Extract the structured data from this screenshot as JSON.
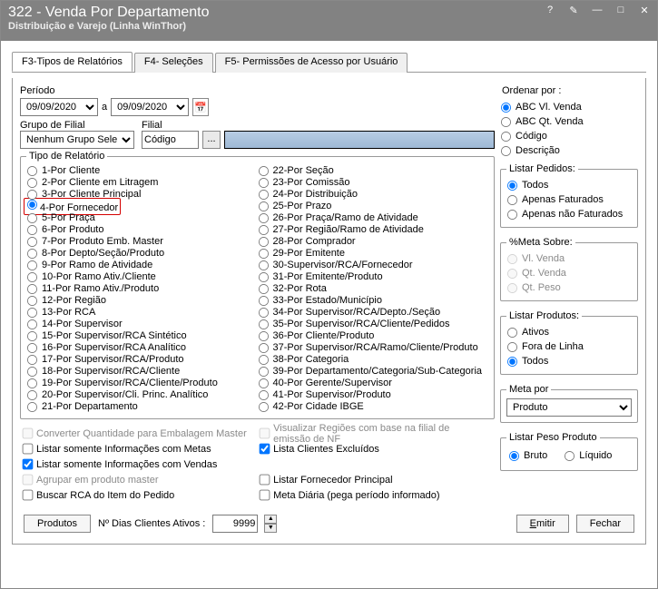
{
  "window": {
    "title": "322 - Venda Por Departamento",
    "subtitle": "Distribuição e Varejo (Linha WinThor)"
  },
  "title_controls": {
    "help": "?",
    "edit": "✎",
    "min": "—",
    "max": "□",
    "close": "✕"
  },
  "tabs": {
    "t1": "F3-Tipos de Relatórios",
    "t2": "F4- Seleções",
    "t3": "F5- Permissões de Acesso por Usuário"
  },
  "periodo": {
    "label": "Período",
    "from": "09/09/2020",
    "a": "a",
    "to": "09/09/2020"
  },
  "grupo": {
    "label": "Grupo de Filial",
    "value": "Nenhum Grupo Selec"
  },
  "filial": {
    "label": "Filial",
    "code": "Código",
    "btn": "...",
    "long": ""
  },
  "tipo_legend": "Tipo de Relatório",
  "tipos_col1": [
    "1-Por Cliente",
    "2-Por Cliente em Litragem",
    "3-Por Cliente Principal",
    "4-Por Fornecedor",
    "5-Por Praça",
    "6-Por Produto",
    "7-Por Produto Emb. Master",
    "8-Por Depto/Seção/Produto",
    "9-Por Ramo de Atividade",
    "10-Por Ramo Ativ./Cliente",
    "11-Por Ramo Ativ./Produto",
    "12-Por Região",
    "13-Por RCA",
    "14-Por Supervisor",
    "15-Por Supervisor/RCA Sintético",
    "16-Por Supervisor/RCA Analítico",
    "17-Por Supervisor/RCA/Produto",
    "18-Por Supervisor/RCA/Cliente",
    "19-Por Supervisor/RCA/Cliente/Produto",
    "20-Por Supervisor/Cli. Princ. Analítico",
    "21-Por Departamento"
  ],
  "tipos_col2": [
    "22-Por Seção",
    "23-Por Comissão",
    "24-Por Distribuição",
    "25-Por Prazo",
    "26-Por Praça/Ramo de Atividade",
    "27-Por Região/Ramo de Atividade",
    "28-Por Comprador",
    "29-Por Emitente",
    "30-Supervisor/RCA/Fornecedor",
    "31-Por Emitente/Produto",
    "32-Por Rota",
    "33-Por Estado/Município",
    "34-Por Supervisor/RCA/Depto./Seção",
    "35-Por Supervisor/RCA/Cliente/Pedidos",
    "36-Por Cliente/Produto",
    "37-Por Supervisor/RCA/Ramo/Cliente/Produto",
    "38-Por Categoria",
    "39-Por Departamento/Categoria/Sub-Categoria",
    "40-Por Gerente/Supervisor",
    "41-Por Supervisor/Produto",
    "42-Por Cidade IBGE"
  ],
  "selected_tipo": "4-Por Fornecedor",
  "ordenar": {
    "label": "Ordenar por :",
    "opts": [
      "ABC Vl. Venda",
      "ABC Qt. Venda",
      "Código",
      "Descrição"
    ],
    "selected": "ABC Vl. Venda"
  },
  "listar_pedidos": {
    "legend": "Listar Pedidos:",
    "opts": [
      "Todos",
      "Apenas Faturados",
      "Apenas não Faturados"
    ],
    "selected": "Todos"
  },
  "meta_sobre": {
    "legend": "%Meta Sobre:",
    "opts": [
      "Vl. Venda",
      "Qt. Venda",
      "Qt. Peso"
    ]
  },
  "listar_produtos": {
    "legend": "Listar Produtos:",
    "opts": [
      "Ativos",
      "Fora de Linha",
      "Todos"
    ],
    "selected": "Todos"
  },
  "meta_por": {
    "legend": "Meta por",
    "value": "Produto"
  },
  "listar_peso": {
    "legend": "Listar Peso Produto",
    "opts": [
      "Bruto",
      "Líquido"
    ],
    "selected": "Bruto"
  },
  "checks": {
    "c1": "Converter Quantidade para Embalagem Master",
    "c2": "Visualizar Regiões com base na filial de emissão de NF",
    "c3": "Listar somente Informações com Metas",
    "c4": "Lista Clientes Excluídos",
    "c5": "Listar somente Informações com Vendas",
    "c6": "Agrupar em produto master",
    "c7": "Listar Fornecedor  Principal",
    "c8": "Buscar RCA do Item do Pedido",
    "c9": "Meta Diária (pega período informado)"
  },
  "bottom": {
    "produtos": "Produtos",
    "dias_label": "Nº Dias Clientes Ativos :",
    "dias_value": "9999",
    "emitir": "Emitir",
    "fechar": "Fechar"
  }
}
